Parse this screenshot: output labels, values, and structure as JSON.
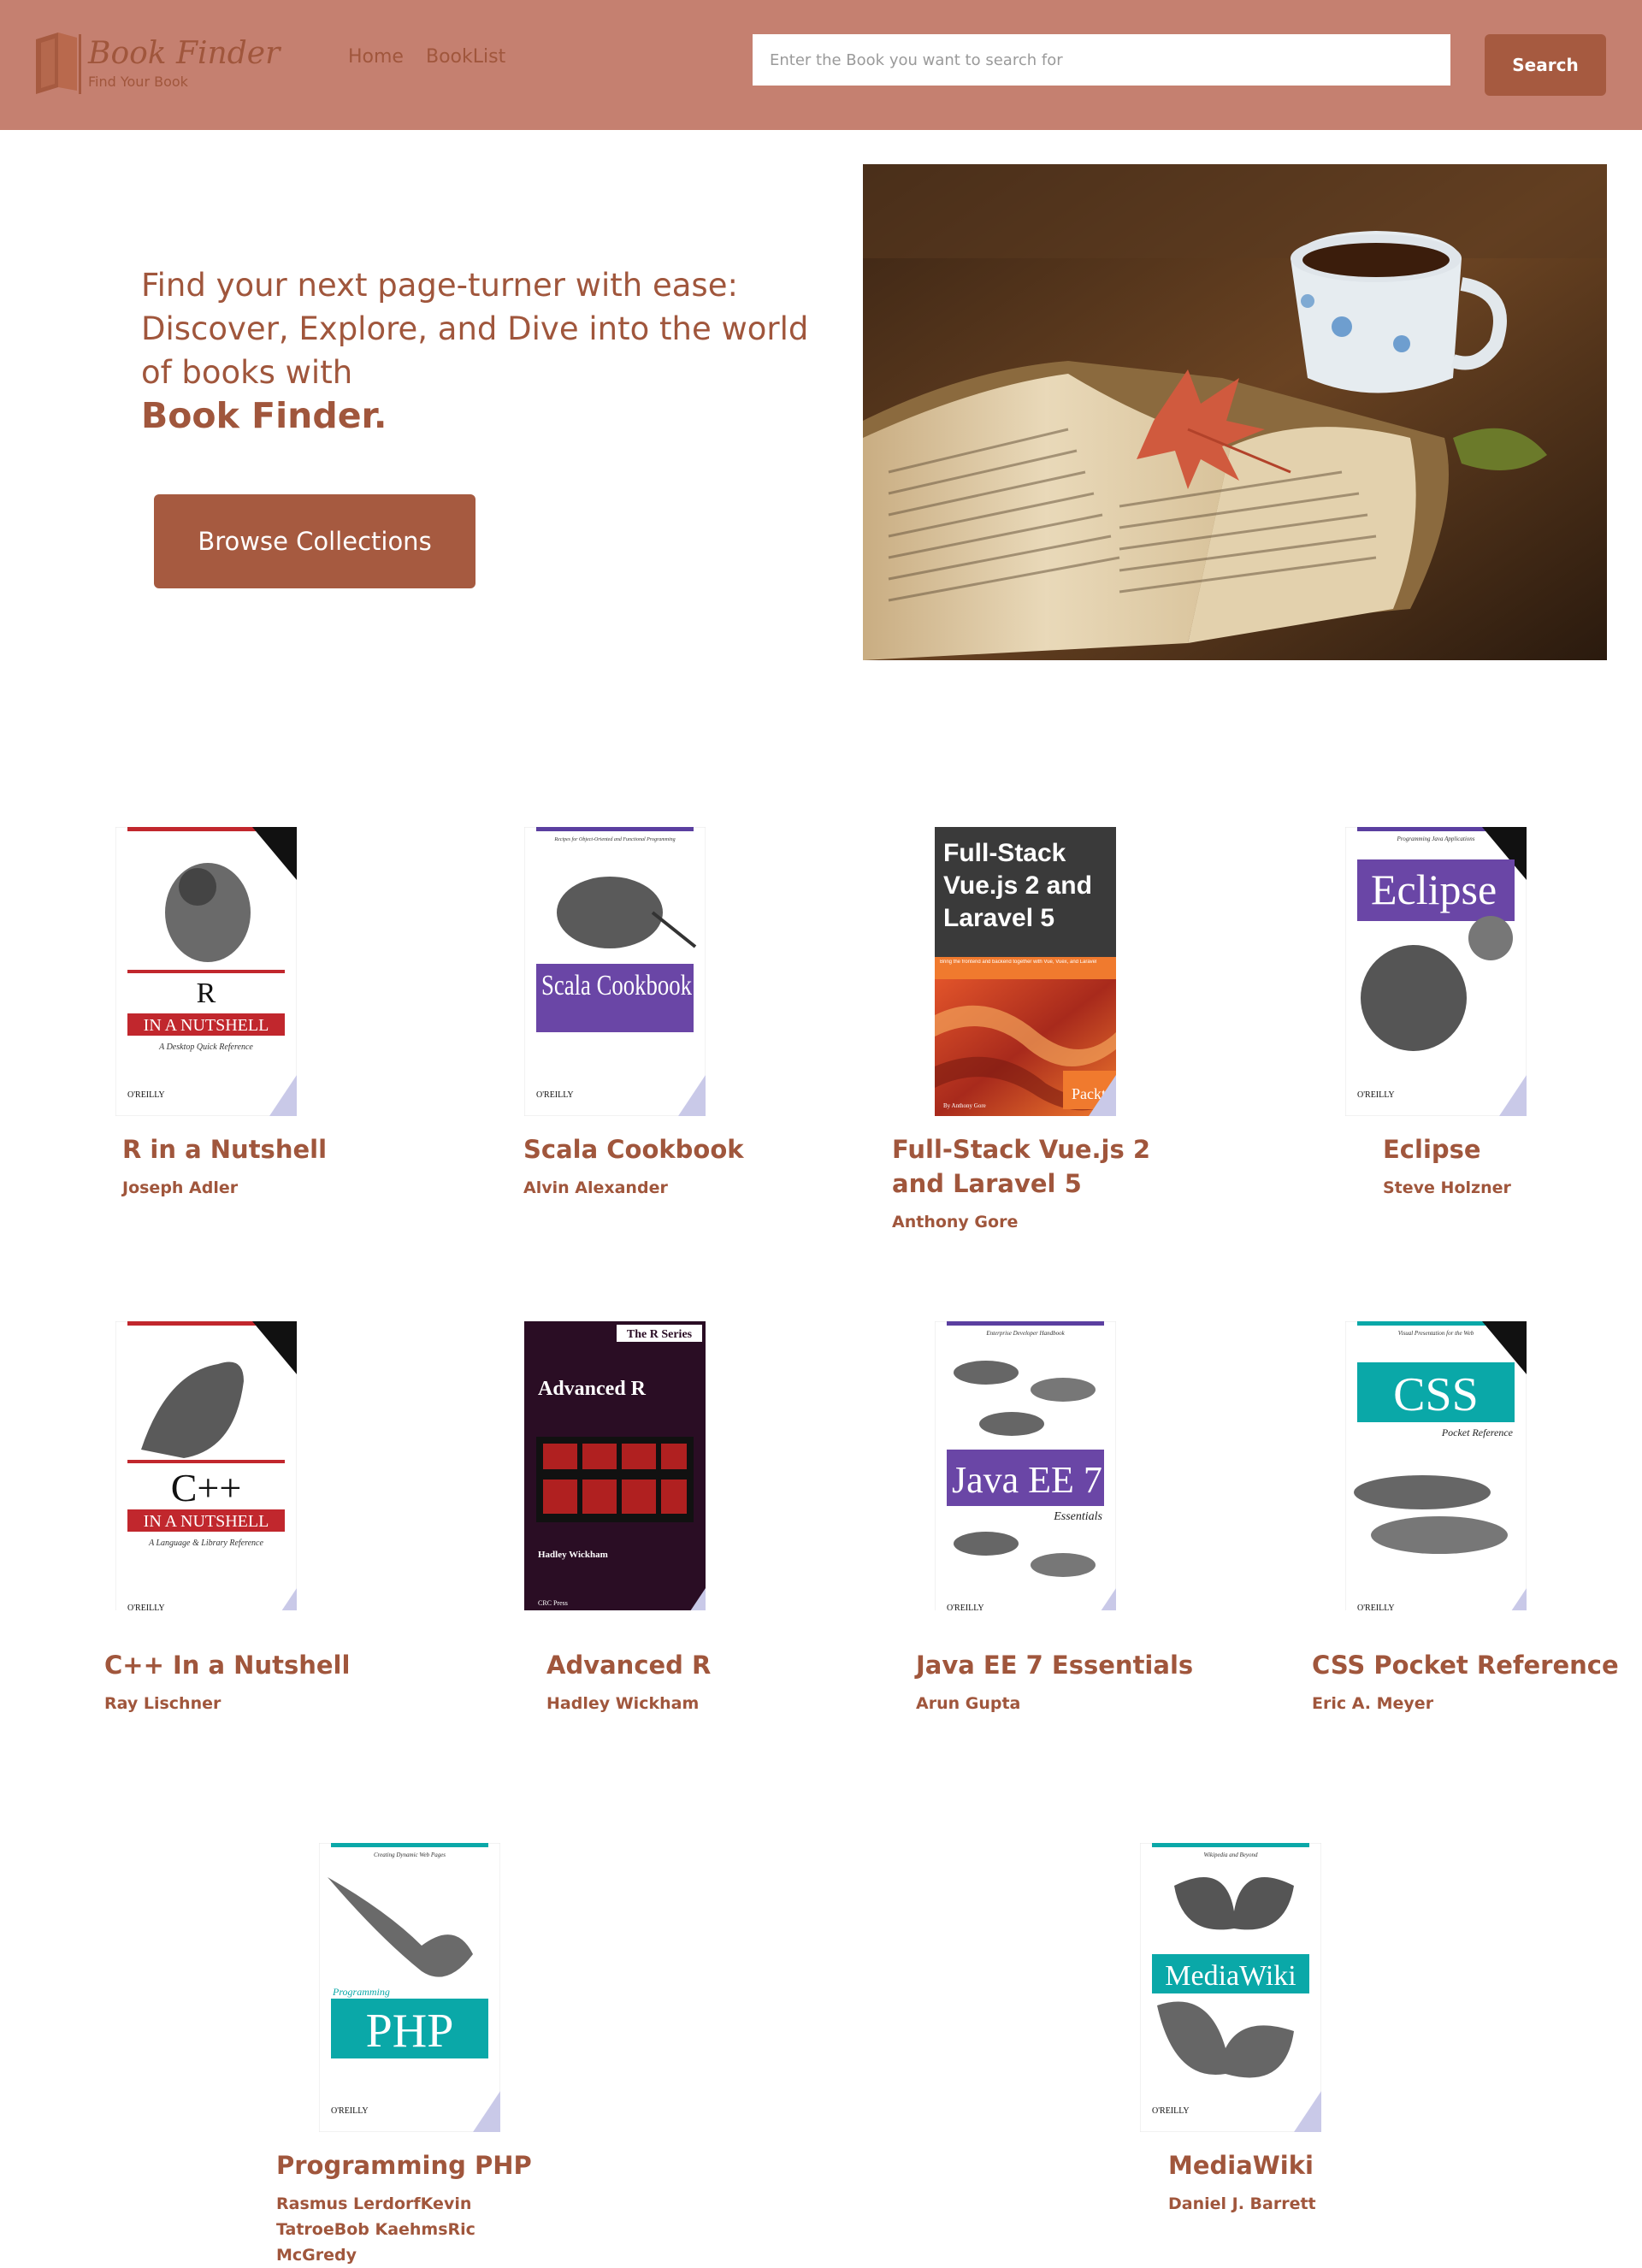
{
  "brand": {
    "name": "Book Finder",
    "tagline": "Find Your Book"
  },
  "nav": {
    "links": [
      "Home",
      "BookList"
    ]
  },
  "search": {
    "placeholder": "Enter the Book you want to search for",
    "button_label": "Search"
  },
  "hero": {
    "text": "Find your next page-turner with ease: Discover, Explore, and Dive into the world of books with",
    "brand": "Book Finder.",
    "button_label": "Browse Collections"
  },
  "books": [
    {
      "title": "R in a Nutshell",
      "author": "Joseph Adler",
      "cover_title": "R",
      "cover_banner": "IN A NUTSHELL",
      "cover_sub": "A Desktop Quick Reference"
    },
    {
      "title": "Scala Cookbook",
      "author": "Alvin Alexander",
      "cover_title": "Scala Cookbook",
      "cover_sub": "Recipes for Object-Oriented and Functional Programming"
    },
    {
      "title": "Full-Stack Vue.js 2 and Laravel 5",
      "author": "Anthony Gore",
      "cover_title": "Full-Stack Vue.js 2 and Laravel 5",
      "cover_sub": "Bring the frontend and backend together with Vue, Vuex, and Laravel",
      "cover_brand": "Packt",
      "cover_byline": "By Anthony Gore"
    },
    {
      "title": "Eclipse",
      "author": "Steve Holzner",
      "cover_title": "Eclipse",
      "cover_sub": "Programming Java Applications"
    },
    {
      "title": "C++ In a Nutshell",
      "author": "Ray Lischner",
      "cover_title": "C++",
      "cover_banner": "IN A NUTSHELL",
      "cover_sub": "A Language & Library Reference"
    },
    {
      "title": "Advanced R",
      "author": "Hadley Wickham",
      "cover_title": "Advanced R",
      "cover_series": "The R Series",
      "cover_byline": "Hadley Wickham",
      "cover_publisher": "CRC Press"
    },
    {
      "title": "Java EE 7 Essentials",
      "author": "Arun Gupta",
      "cover_title": "Java EE 7",
      "cover_sub": "Essentials",
      "cover_top": "Enterprise Developer Handbook"
    },
    {
      "title": "CSS Pocket Reference",
      "author": "Eric A. Meyer",
      "cover_title": "CSS",
      "cover_sub": "Pocket Reference",
      "cover_top": "Visual Presentation for the Web"
    },
    {
      "title": "Programming PHP",
      "author": "Rasmus LerdorfKevin TatroeBob KaehmsRic McGredy",
      "cover_title": "PHP",
      "cover_sub": "Programming",
      "cover_top": "Creating Dynamic Web Pages"
    },
    {
      "title": "MediaWiki",
      "author": "Daniel J. Barrett",
      "cover_title": "MediaWiki",
      "cover_top": "Wikipedia and Beyond"
    }
  ],
  "publisher": "O'REILLY",
  "colors": {
    "navbar": "#c58070",
    "accent": "#a65a40",
    "text": "#a0563c"
  }
}
